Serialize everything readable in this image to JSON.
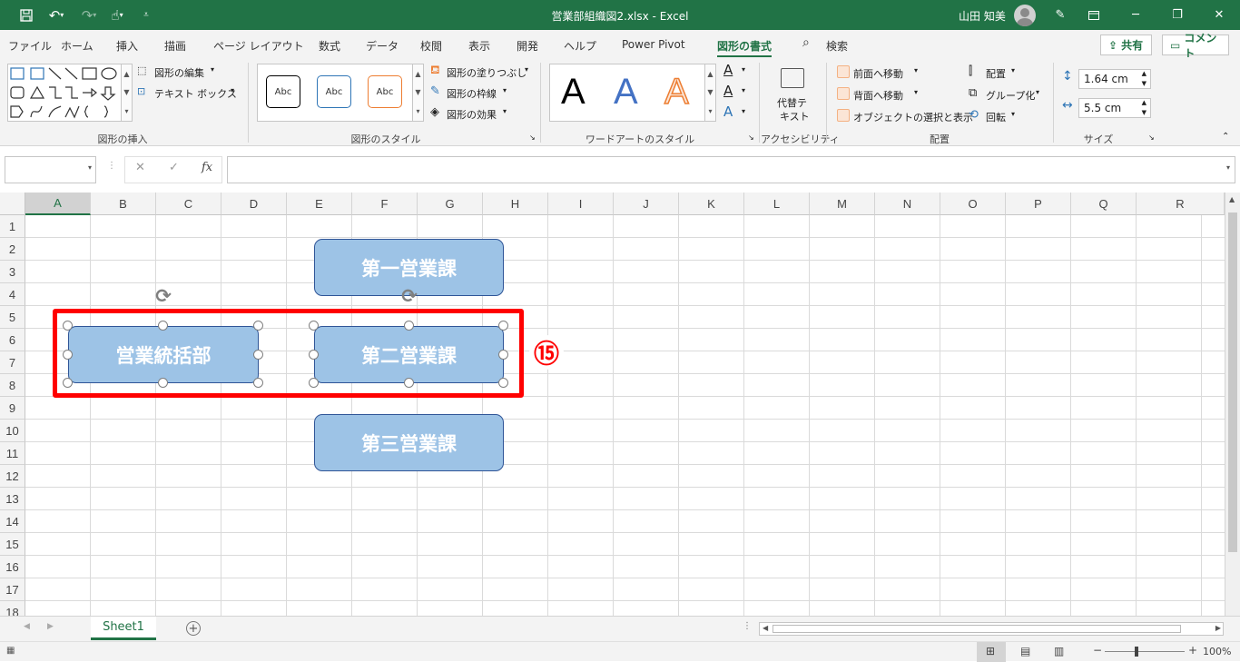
{
  "titlebar": {
    "title": "営業部組織図2.xlsx  -  Excel",
    "user": "山田 知美"
  },
  "menu": {
    "tabs": [
      "ファイル",
      "ホーム",
      "挿入",
      "描画",
      "ページ レイアウト",
      "数式",
      "データ",
      "校閲",
      "表示",
      "開発",
      "ヘルプ",
      "Power Pivot",
      "図形の書式",
      "検索"
    ],
    "share": "共有",
    "comment": "コメント"
  },
  "ribbon": {
    "insert": {
      "edit": "図形の編集",
      "textbox": "テキスト ボックス",
      "label": "図形の挿入"
    },
    "styles": {
      "abc": "Abc",
      "fill": "図形の塗りつぶし",
      "outline": "図形の枠線",
      "effects": "図形の効果",
      "label": "図形のスタイル"
    },
    "wordart": {
      "letter": "A",
      "label": "ワードアートのスタイル"
    },
    "access": {
      "alt1": "代替テ",
      "alt2": "キスト",
      "label": "アクセシビリティ"
    },
    "arrange": {
      "front": "前面へ移動",
      "back": "背面へ移動",
      "selpane": "オブジェクトの選択と表示",
      "align": "配置",
      "group": "グループ化",
      "rotate": "回転",
      "label": "配置"
    },
    "size": {
      "height": "1.64 cm",
      "width": "5.5 cm",
      "label": "サイズ"
    }
  },
  "formula": {
    "namebox": "",
    "fx": "fx",
    "value": ""
  },
  "columns": [
    "A",
    "B",
    "C",
    "D",
    "E",
    "F",
    "G",
    "H",
    "I",
    "J",
    "K",
    "L",
    "M",
    "N",
    "O",
    "P",
    "Q",
    "R"
  ],
  "rows": [
    "1",
    "2",
    "3",
    "4",
    "5",
    "6",
    "7",
    "8",
    "9",
    "10",
    "11",
    "12",
    "13",
    "14",
    "15",
    "16",
    "17",
    "18"
  ],
  "shapes": {
    "dept1": "第一営業課",
    "head": "営業統括部",
    "dept2": "第二営業課",
    "dept3": "第三営業課"
  },
  "annotation": {
    "step": "⑮",
    "color": "#ff0000"
  },
  "sheets": {
    "active": "Sheet1"
  },
  "status": {
    "zoom": "100%"
  },
  "colors": {
    "brand": "#217346",
    "shapeFill": "#9dc3e6",
    "shapeBorder": "#2f5597"
  }
}
